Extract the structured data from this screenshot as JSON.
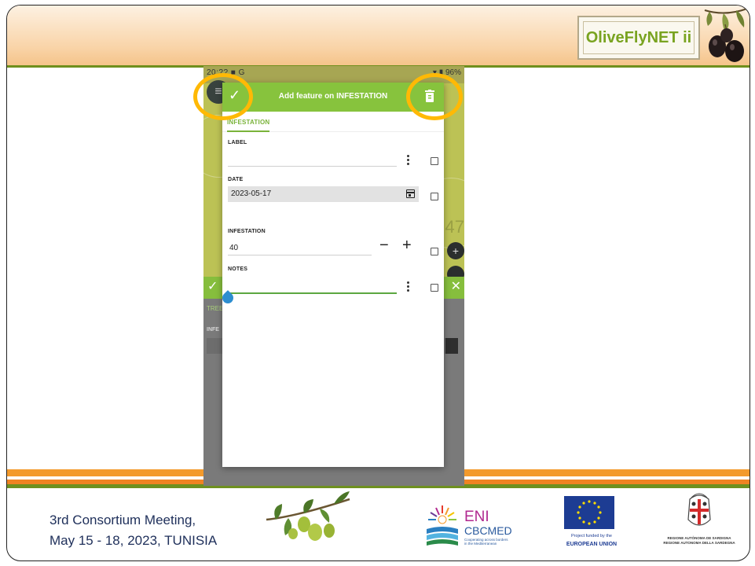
{
  "slide": {
    "header": {
      "logo_text": "OliveFlyNET ii"
    },
    "footer": {
      "line1": "3rd Consortium Meeting,",
      "line2": "May 15 - 18, 2023, TUNISIA",
      "eni": {
        "title": "ENI",
        "subtitle": "CBCMED",
        "tagline": "Cooperating across borders in the Mediterranean"
      },
      "eu": {
        "line1": "Project funded by the",
        "line2": "EUROPEAN UNION"
      },
      "sardinia": {
        "line1": "REGIONE AUTÒNOMA DE SARDIGNA",
        "line2": "REGIONE AUTONOMA DELLA SARDEGNA"
      }
    }
  },
  "phone": {
    "status": {
      "time": "20:??",
      "signal": "G",
      "battery": "96%"
    },
    "map_number": "47",
    "background_form": {
      "tab": "TREE",
      "field_label": "INFE"
    },
    "dialog": {
      "title": "Add feature on INFESTATION",
      "tab": "INFESTATION",
      "fields": {
        "label": {
          "name": "LABEL",
          "value": ""
        },
        "date": {
          "name": "DATE",
          "value": "2023-05-17"
        },
        "infestation": {
          "name": "INFESTATION",
          "value": "40"
        },
        "notes": {
          "name": "NOTES",
          "value": ""
        }
      }
    }
  },
  "colors": {
    "header_green": "#87c33d",
    "highlight": "#ffb905",
    "accent_orange": "#ef8322"
  }
}
